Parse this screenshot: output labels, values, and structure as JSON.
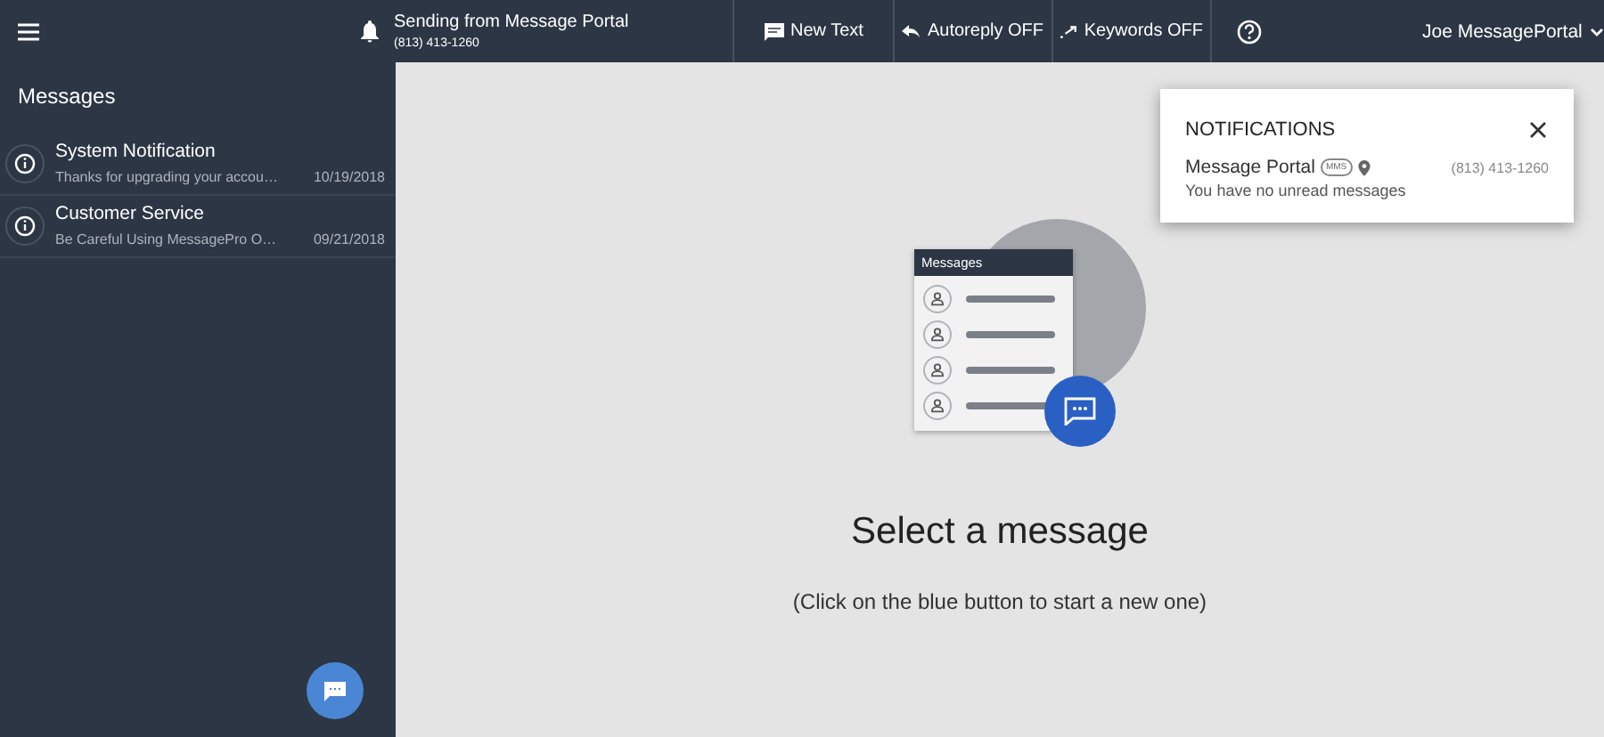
{
  "topbar": {
    "sender_title": "Sending from Message Portal",
    "sender_number": "(813) 413-1260",
    "actions": [
      {
        "label": "New Text",
        "kind": "new"
      },
      {
        "label": "Autoreply OFF",
        "kind": "autoreply"
      },
      {
        "label": "Keywords OFF",
        "kind": "keywords"
      }
    ],
    "user": "Joe MessagePortal"
  },
  "sidebar": {
    "title": "Messages",
    "conversations": [
      {
        "name": "System Notification",
        "preview": "Thanks for upgrading your accou…",
        "date": "10/19/2018"
      },
      {
        "name": "Customer Service",
        "preview": "Be Careful Using MessagePro O…",
        "date": "09/21/2018"
      }
    ]
  },
  "empty_state": {
    "illustration_title": "Messages",
    "heading": "Select a message",
    "hint": "(Click on the blue button to start a new one)"
  },
  "notifications": {
    "title": "NOTIFICATIONS",
    "items": [
      {
        "name": "Message Portal",
        "badge": "MMS",
        "number": "(813) 413-1260",
        "message": "You have no unread messages"
      }
    ]
  }
}
